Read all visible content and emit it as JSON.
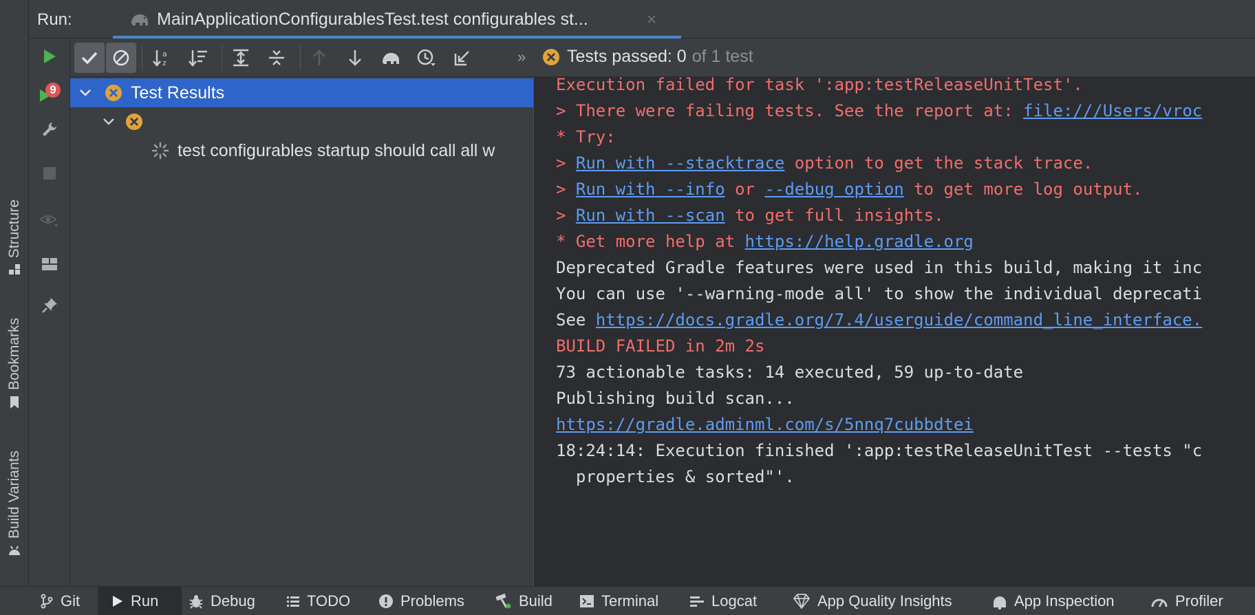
{
  "side_tabs": {
    "structure": "Structure",
    "bookmarks": "Bookmarks",
    "build_variants": "Build Variants"
  },
  "header": {
    "run_label": "Run:",
    "tab_title": "MainApplicationConfigurablesTest.test configurables st...",
    "close_glyph": "×"
  },
  "tool_column": {
    "failed_count": "9"
  },
  "toolbar": {
    "more_glyph": "»",
    "status_label": "Tests passed: 0",
    "status_of": "of 1 test"
  },
  "tree": {
    "root_label": "Test Results",
    "test_label": "test configurables startup should call all w"
  },
  "console": {
    "line1": "Execution failed for task ':app:testReleaseUnitTest'.",
    "line2_prefix": "> There were failing tests. See the report at: ",
    "line2_link": "file:///Users/vroc",
    "line3": "* Try:",
    "line4_prefix": "> ",
    "line4_link": "Run with --stacktrace",
    "line4_suffix": " option to get the stack trace.",
    "line5_prefix": "> ",
    "line5_link1": "Run with --info",
    "line5_mid": " or ",
    "line5_link2": "--debug option",
    "line5_suffix": " to get more log output.",
    "line6_prefix": "> ",
    "line6_link": "Run with --scan",
    "line6_suffix": " to get full insights.",
    "line7_prefix": "* Get more help at ",
    "line7_link": "https://help.gradle.org",
    "line8": "Deprecated Gradle features were used in this build, making it inc",
    "line9": "You can use '--warning-mode all' to show the individual deprecati",
    "line10_prefix": "See ",
    "line10_link": "https://docs.gradle.org/7.4/userguide/command_line_interface.",
    "line11": "BUILD FAILED in 2m 2s",
    "line12": "73 actionable tasks: 14 executed, 59 up-to-date",
    "line13": "Publishing build scan...",
    "line14_link": "https://gradle.adminml.com/s/5nnq7cubbdtei",
    "line15": "18:24:14: Execution finished ':app:testReleaseUnitTest --tests \"c",
    "line16": "  properties & sorted\"'."
  },
  "bottom_tabs": {
    "git": "Git",
    "run": "Run",
    "debug": "Debug",
    "todo": "TODO",
    "problems": "Problems",
    "build": "Build",
    "terminal": "Terminal",
    "logcat": "Logcat",
    "aqi": "App Quality Insights",
    "app_inspection": "App Inspection",
    "profiler": "Profiler"
  },
  "colors": {
    "accent": "#4a88c7",
    "selection": "#2f65ca",
    "error_text": "#f26d6d",
    "link": "#5f9cf3",
    "run_green": "#4db34d",
    "warning_orange": "#e0a33a"
  }
}
